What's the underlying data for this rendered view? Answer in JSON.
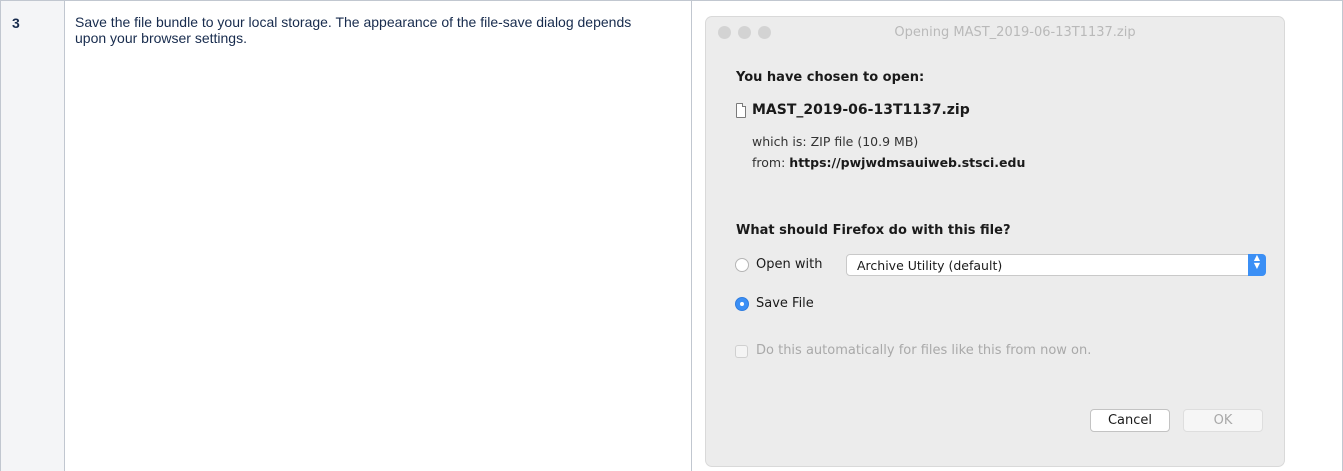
{
  "step": {
    "number": "3",
    "text": "Save the file bundle to your local storage. The appearance of the file-save dialog depends upon your browser settings."
  },
  "dialog": {
    "title": "Opening MAST_2019-06-13T1137.zip",
    "chosen_heading": "You have chosen to open:",
    "file_icon": "document-icon",
    "file_name": "MAST_2019-06-13T1137.zip",
    "which_is_label": "which is:",
    "which_is_value": "ZIP file (10.9 MB)",
    "from_label": "from:",
    "from_value": "https://pwjwdmsauiweb.stsci.edu",
    "question": "What should Firefox do with this file?",
    "open_with_label": "Open with",
    "open_with_app": "Archive Utility (default)",
    "save_file_label": "Save File",
    "auto_label": "Do this automatically for files like this from now on.",
    "cancel_label": "Cancel",
    "ok_label": "OK",
    "selected_option": "save-file",
    "accent_color": "#3b8ff5"
  }
}
